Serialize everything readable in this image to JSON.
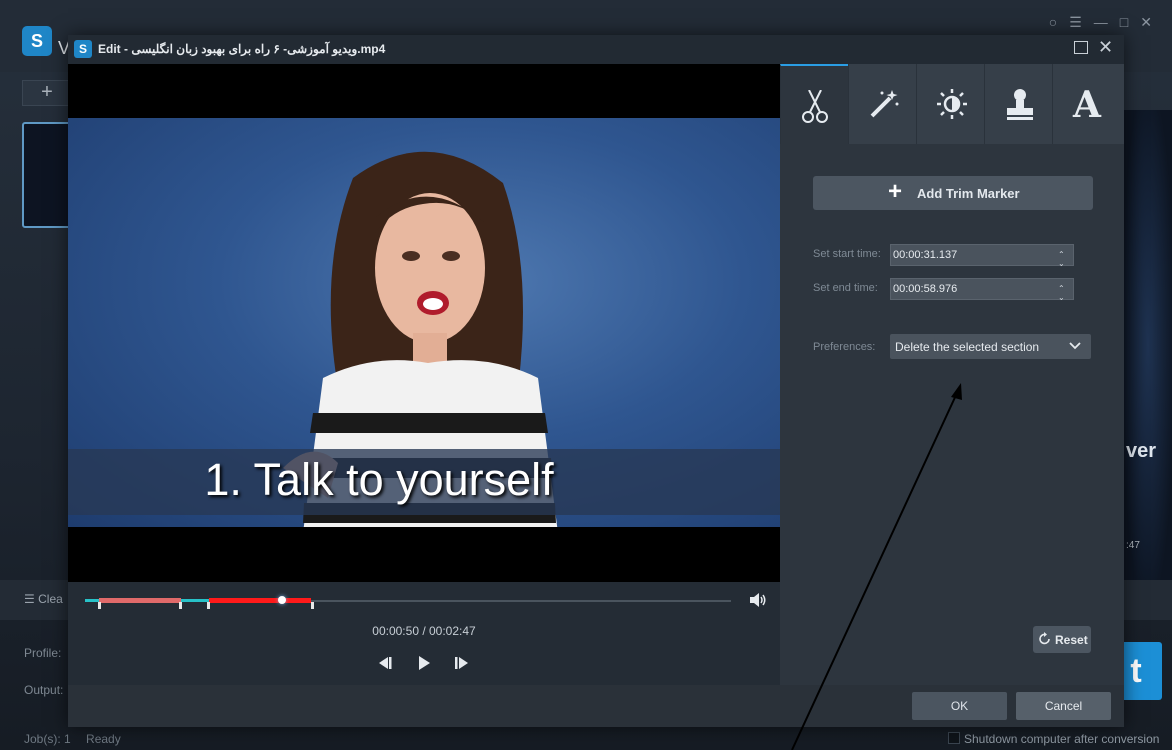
{
  "background_app": {
    "title_fragment": "V",
    "add_symbol": "+",
    "right_text": "ver",
    "clear_label": "Clea",
    "profile_label": "Profile:",
    "output_label": "Output:",
    "convert_fragment": "t",
    "timecode_fragment": "47",
    "status_jobs": "Job(s): 1",
    "status_state": "Ready",
    "shutdown_label": "Shutdown computer after conversion"
  },
  "dialog": {
    "title": "Edit - ویدیو آموزشی- ۶ راه برای بهبود زبان انگلیسی.mp4",
    "subtitle_text": "1. Talk to yourself",
    "time_readout": "00:00:50 / 00:02:47",
    "tabs": [
      "trim",
      "effects",
      "adjust",
      "watermark",
      "text"
    ],
    "text_tab_glyph": "A",
    "add_trim_label": "Add Trim Marker",
    "add_trim_symbol": "+",
    "start_label": "Set start time:",
    "start_value": "00:00:31.137",
    "end_label": "Set end time:",
    "end_value": "00:00:58.976",
    "preferences_label": "Preferences:",
    "preferences_value": "Delete the selected section",
    "reset_label": "Reset",
    "ok_label": "OK",
    "cancel_label": "Cancel"
  },
  "colors": {
    "accent": "#2a9de4",
    "trim_segment_red": "#ff1a1a",
    "trim_segment_pink": "#e06a6a",
    "track_cyan": "#28c2c8"
  }
}
